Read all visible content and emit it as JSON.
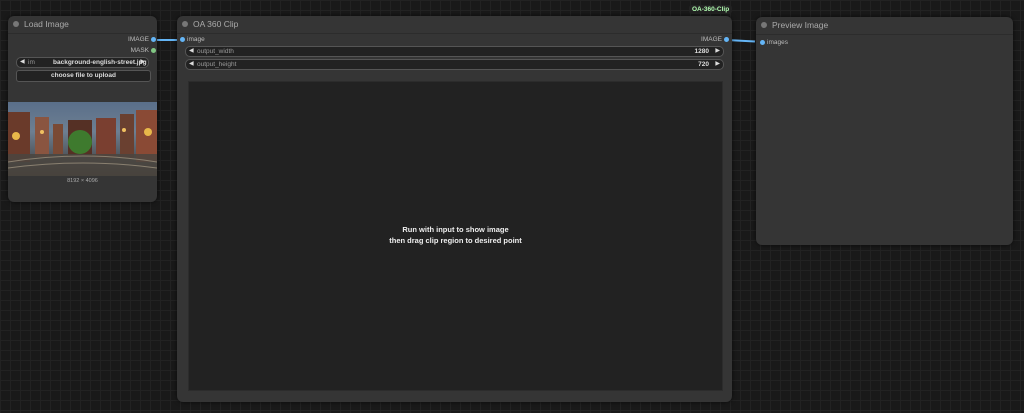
{
  "colors": {
    "wire": "#64b5f6",
    "image_slot": "#64b5f6",
    "mask_slot": "#81c784",
    "badge_text": "#b2ffb2"
  },
  "load_image": {
    "title": "Load Image",
    "outputs": [
      {
        "label": "IMAGE"
      },
      {
        "label": "MASK"
      }
    ],
    "image_widget": {
      "label": "im",
      "value": "background-english-street.jpg"
    },
    "upload_label": "choose file to upload",
    "dims": "8192 × 4096"
  },
  "clip": {
    "badge": "OA-360-Clip",
    "title": "OA 360 Clip",
    "input_label": "image",
    "output_label": "IMAGE",
    "widgets": [
      {
        "label": "output_width",
        "value": "1280"
      },
      {
        "label": "output_height",
        "value": "720"
      }
    ],
    "canvas_line1": "Run with input to show image",
    "canvas_line2": "then drag clip region to desired point"
  },
  "preview": {
    "title": "Preview Image",
    "input_label": "images"
  }
}
